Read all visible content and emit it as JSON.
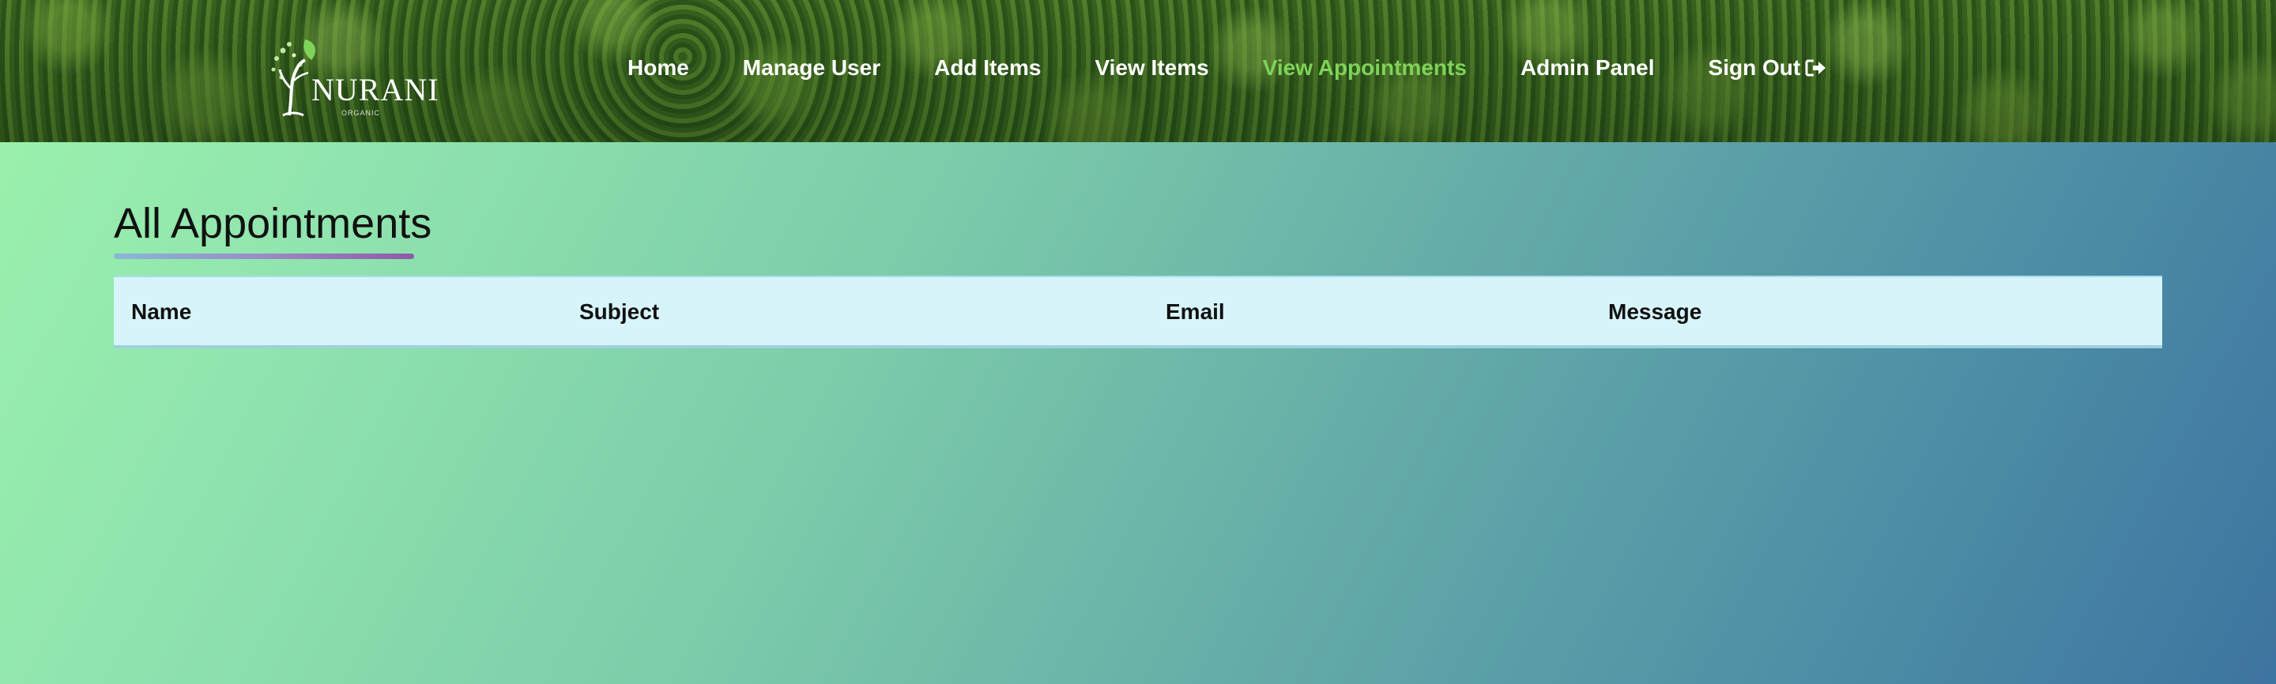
{
  "brand": {
    "name": "NURANI",
    "tagline": "ORGANIC"
  },
  "nav": {
    "items": [
      {
        "label": "Home",
        "active": false
      },
      {
        "label": "Manage User",
        "active": false
      },
      {
        "label": "Add Items",
        "active": false
      },
      {
        "label": "View Items",
        "active": false
      },
      {
        "label": "View Appointments",
        "active": true
      },
      {
        "label": "Admin Panel",
        "active": false
      },
      {
        "label": "Sign Out",
        "active": false,
        "icon": "sign-out-icon"
      }
    ],
    "active_color": "#7fd35a",
    "text_color": "#ffffff"
  },
  "main": {
    "title": "All Appointments",
    "table": {
      "columns": [
        "Name",
        "Subject",
        "Email",
        "Message"
      ],
      "rows": []
    }
  },
  "colors": {
    "background_start": "#9cf2ac",
    "background_end": "#3e74a0",
    "table_header_bg": "#d6f4fa",
    "underline_start": "#89b7d6",
    "underline_end": "#8e5aa8"
  }
}
